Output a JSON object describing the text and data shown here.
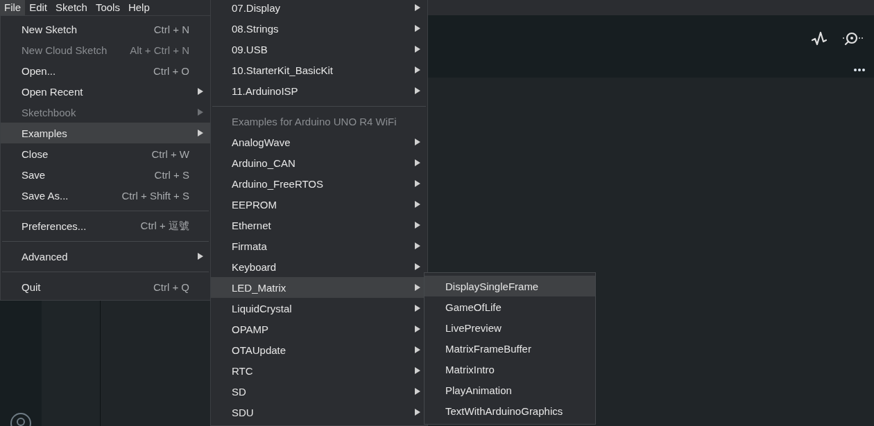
{
  "menubar": [
    {
      "label": "File",
      "selected": true
    },
    {
      "label": "Edit",
      "selected": false
    },
    {
      "label": "Sketch",
      "selected": false
    },
    {
      "label": "Tools",
      "selected": false
    },
    {
      "label": "Help",
      "selected": false
    }
  ],
  "file_menu": {
    "items": [
      {
        "kind": "item",
        "label": "New Sketch",
        "shortcut": "Ctrl + N",
        "disabled": false,
        "selected": false,
        "submenu": false
      },
      {
        "kind": "item",
        "label": "New Cloud Sketch",
        "shortcut": "Alt + Ctrl + N",
        "disabled": true,
        "selected": false,
        "submenu": false
      },
      {
        "kind": "item",
        "label": "Open...",
        "shortcut": "Ctrl + O",
        "disabled": false,
        "selected": false,
        "submenu": false
      },
      {
        "kind": "item",
        "label": "Open Recent",
        "disabled": false,
        "selected": false,
        "submenu": true
      },
      {
        "kind": "item",
        "label": "Sketchbook",
        "disabled": true,
        "selected": false,
        "submenu": true
      },
      {
        "kind": "item",
        "label": "Examples",
        "disabled": false,
        "selected": true,
        "submenu": true
      },
      {
        "kind": "item",
        "label": "Close",
        "shortcut": "Ctrl + W",
        "disabled": false,
        "selected": false,
        "submenu": false
      },
      {
        "kind": "item",
        "label": "Save",
        "shortcut": "Ctrl + S",
        "disabled": false,
        "selected": false,
        "submenu": false
      },
      {
        "kind": "item",
        "label": "Save As...",
        "shortcut": "Ctrl + Shift + S",
        "disabled": false,
        "selected": false,
        "submenu": false
      },
      {
        "kind": "separator"
      },
      {
        "kind": "item",
        "label": "Preferences...",
        "shortcut": "Ctrl + 逗號",
        "disabled": false,
        "selected": false,
        "submenu": false
      },
      {
        "kind": "separator"
      },
      {
        "kind": "item",
        "label": "Advanced",
        "disabled": false,
        "selected": false,
        "submenu": true
      },
      {
        "kind": "separator"
      },
      {
        "kind": "item",
        "label": "Quit",
        "shortcut": "Ctrl + Q",
        "disabled": false,
        "selected": false,
        "submenu": false
      }
    ]
  },
  "examples_menu": {
    "items": [
      {
        "kind": "item",
        "label": "07.Display",
        "selected": false,
        "submenu": true
      },
      {
        "kind": "item",
        "label": "08.Strings",
        "selected": false,
        "submenu": true
      },
      {
        "kind": "item",
        "label": "09.USB",
        "selected": false,
        "submenu": true
      },
      {
        "kind": "item",
        "label": "10.StarterKit_BasicKit",
        "selected": false,
        "submenu": true
      },
      {
        "kind": "item",
        "label": "11.ArduinoISP",
        "selected": false,
        "submenu": true
      },
      {
        "kind": "separator"
      },
      {
        "kind": "header",
        "label": "Examples for Arduino UNO R4 WiFi"
      },
      {
        "kind": "item",
        "label": "AnalogWave",
        "selected": false,
        "submenu": true
      },
      {
        "kind": "item",
        "label": "Arduino_CAN",
        "selected": false,
        "submenu": true
      },
      {
        "kind": "item",
        "label": "Arduino_FreeRTOS",
        "selected": false,
        "submenu": true
      },
      {
        "kind": "item",
        "label": "EEPROM",
        "selected": false,
        "submenu": true
      },
      {
        "kind": "item",
        "label": "Ethernet",
        "selected": false,
        "submenu": true
      },
      {
        "kind": "item",
        "label": "Firmata",
        "selected": false,
        "submenu": true
      },
      {
        "kind": "item",
        "label": "Keyboard",
        "selected": false,
        "submenu": true
      },
      {
        "kind": "item",
        "label": "LED_Matrix",
        "selected": true,
        "submenu": true
      },
      {
        "kind": "item",
        "label": "LiquidCrystal",
        "selected": false,
        "submenu": true
      },
      {
        "kind": "item",
        "label": "OPAMP",
        "selected": false,
        "submenu": true
      },
      {
        "kind": "item",
        "label": "OTAUpdate",
        "selected": false,
        "submenu": true
      },
      {
        "kind": "item",
        "label": "RTC",
        "selected": false,
        "submenu": true
      },
      {
        "kind": "item",
        "label": "SD",
        "selected": false,
        "submenu": true
      },
      {
        "kind": "item",
        "label": "SDU",
        "selected": false,
        "submenu": true
      }
    ]
  },
  "led_matrix_menu": {
    "items": [
      {
        "kind": "item",
        "label": "DisplaySingleFrame",
        "selected": true,
        "submenu": false
      },
      {
        "kind": "item",
        "label": "GameOfLife",
        "selected": false,
        "submenu": false
      },
      {
        "kind": "item",
        "label": "LivePreview",
        "selected": false,
        "submenu": false
      },
      {
        "kind": "item",
        "label": "MatrixFrameBuffer",
        "selected": false,
        "submenu": false
      },
      {
        "kind": "item",
        "label": "MatrixIntro",
        "selected": false,
        "submenu": false
      },
      {
        "kind": "item",
        "label": "PlayAnimation",
        "selected": false,
        "submenu": false
      },
      {
        "kind": "item",
        "label": "TextWithArduinoGraphics",
        "selected": false,
        "submenu": false
      }
    ]
  }
}
